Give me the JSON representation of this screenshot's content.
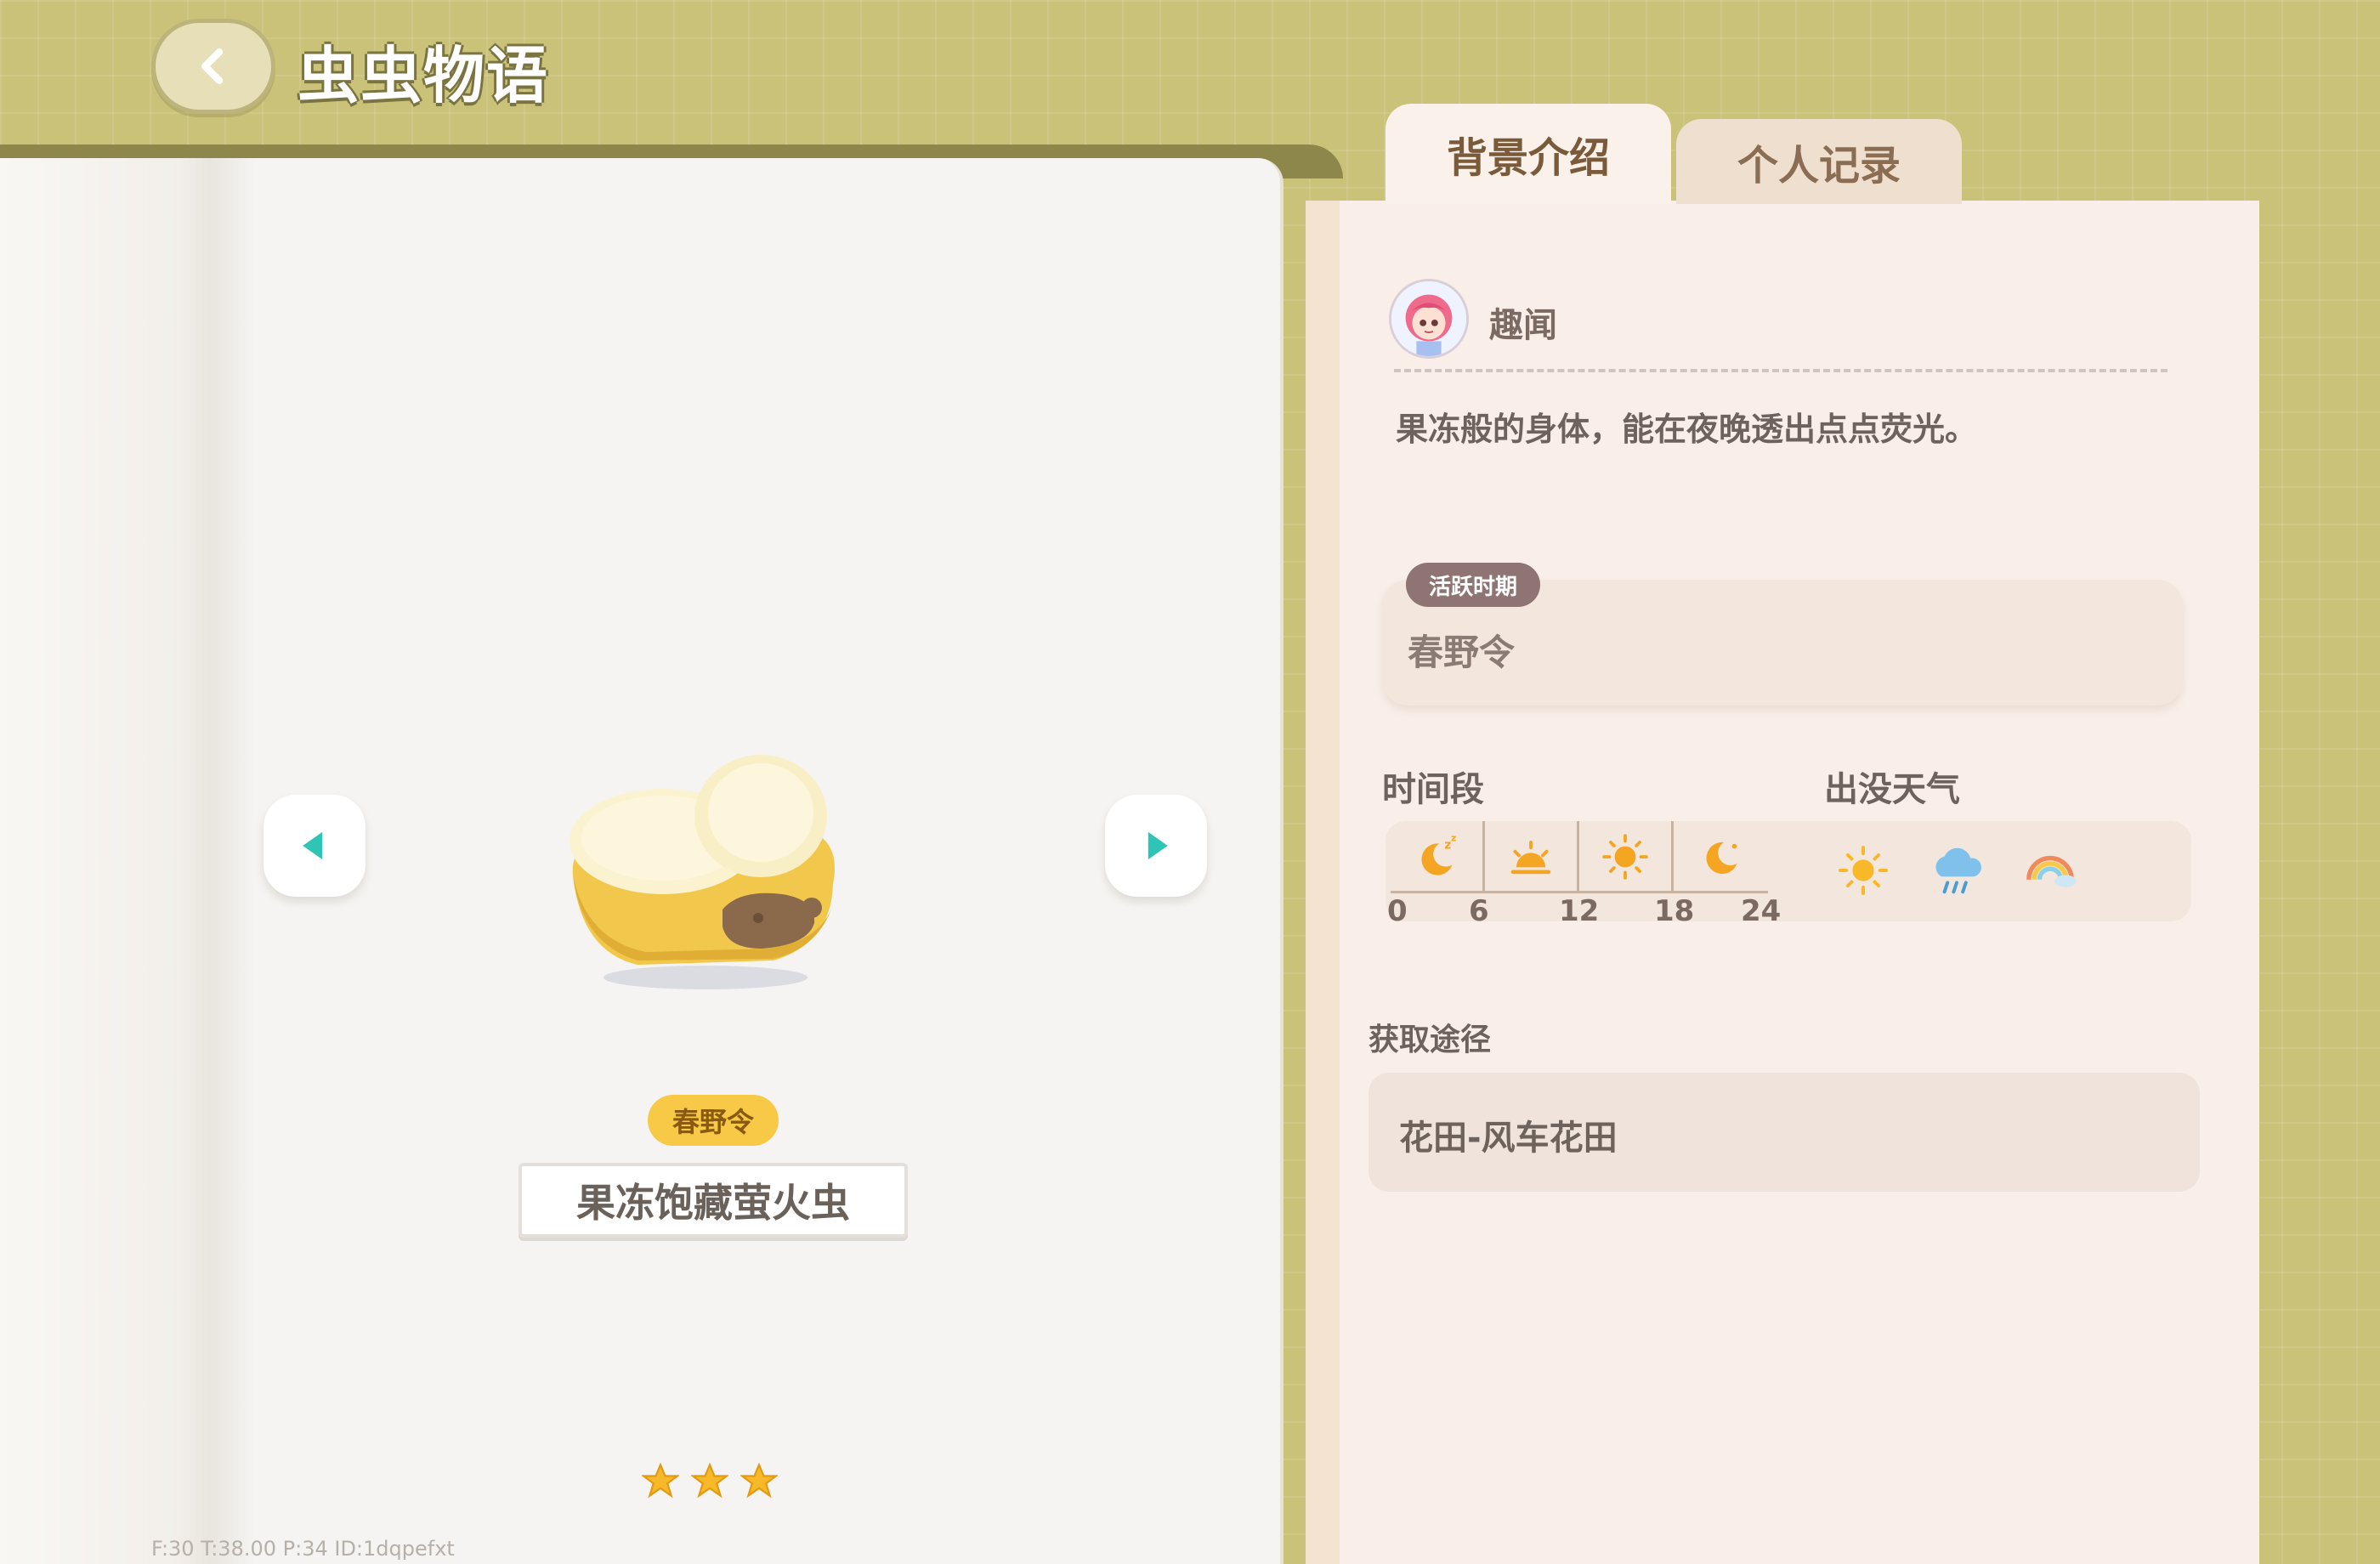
{
  "header": {
    "back_icon": "back-arrow-icon",
    "title": "虫虫物语"
  },
  "tabs": [
    {
      "label": "背景介绍",
      "active": true
    },
    {
      "label": "个人记录",
      "active": false
    }
  ],
  "insect": {
    "season_chip": "春野令",
    "name": "果冻饱藏萤火虫",
    "stars": 3
  },
  "nav": {
    "prev_icon": "left-triangle-icon",
    "next_icon": "right-triangle-icon",
    "accent_color": "#2ec4b6"
  },
  "debug": "F:30    T:38.00    P:34    ID:1dqpefxt",
  "background": {
    "fun_label": "趣闻",
    "fun_text": "果冻般的身体，能在夜晚透出点点荧光。",
    "active_period_badge": "活跃时期",
    "active_period_value": "春野令",
    "time_label": "时间段",
    "time_icons": [
      "moon-sleep-icon",
      "sunrise-icon",
      "sun-icon",
      "moon-icon"
    ],
    "time_ticks": [
      "0",
      "6",
      "12",
      "18",
      "24"
    ],
    "weather_label": "出没天气",
    "weather_icons": [
      "sunny-icon",
      "rain-cloud-icon",
      "rainbow-icon"
    ],
    "source_label": "获取途径",
    "source_value": "花田-风车花田"
  },
  "colors": {
    "background": "#cbc27a",
    "chip": "#f7c947",
    "badge": "#8f7474",
    "icon_orange": "#f4a623"
  }
}
